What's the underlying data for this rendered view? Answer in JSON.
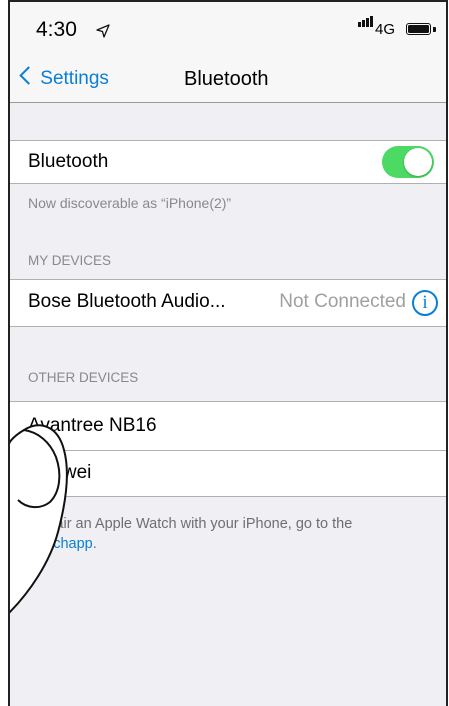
{
  "status_bar": {
    "time": "4:30",
    "network": "4G",
    "icons": [
      "location-arrow-icon",
      "signal-icon",
      "battery-icon"
    ]
  },
  "nav": {
    "back_label": "Settings",
    "title": "Bluetooth"
  },
  "bluetooth": {
    "label": "Bluetooth",
    "enabled": true,
    "discoverable_text": "Now discoverable as “iPhone(2)”"
  },
  "my_devices": {
    "header": "MY DEVICES",
    "items": [
      {
        "name": "Bose Bluetooth Audio...",
        "status": "Not Connected",
        "icon": "info-icon"
      }
    ]
  },
  "other_devices": {
    "header": "OTHER DEVICES",
    "items": [
      {
        "name": "Avantree NB16"
      },
      {
        "name": "Huawei"
      }
    ]
  },
  "watch_note": {
    "text": "To pair an Apple Watch with your iPhone, go to the",
    "link": "Watchapp",
    "suffix": "."
  },
  "colors": {
    "accent": "#0a7fd6",
    "toggle_on": "#4cd964",
    "background": "#efeff4"
  }
}
